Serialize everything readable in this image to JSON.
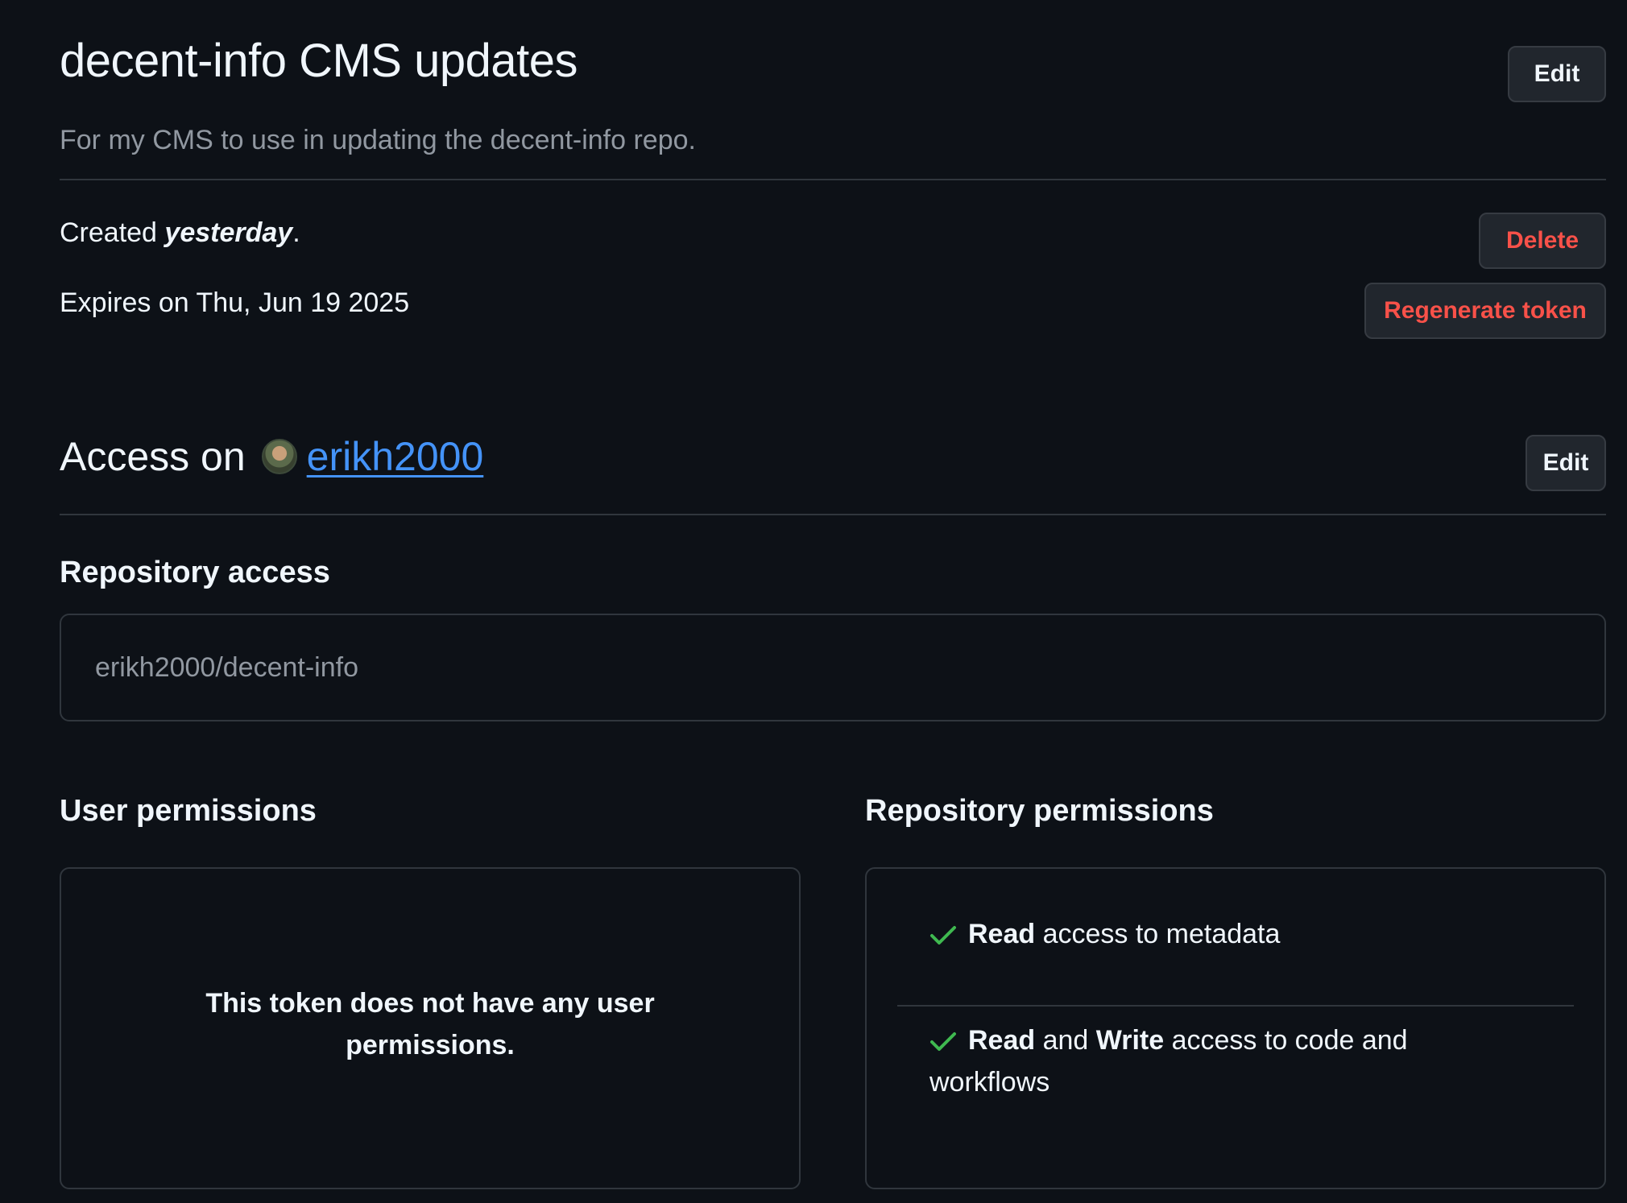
{
  "token": {
    "title": "decent-info CMS updates",
    "description": "For my CMS to use in updating the decent-info repo.",
    "created_prefix": "Created ",
    "created_when": "yesterday",
    "created_suffix": ".",
    "expires": "Expires on Thu, Jun 19 2025"
  },
  "buttons": {
    "edit_label": "Edit",
    "delete_label": "Delete",
    "regenerate_label": "Regenerate token",
    "access_edit_label": "Edit"
  },
  "access": {
    "heading_prefix": "Access on",
    "username": "erikh2000"
  },
  "repository_access": {
    "heading": "Repository access",
    "repo": "erikh2000/decent-info"
  },
  "user_permissions": {
    "heading": "User permissions",
    "empty_message": "This token does not have any user permissions."
  },
  "repository_permissions": {
    "heading": "Repository permissions",
    "items": [
      {
        "icon": "check-icon",
        "parts": [
          {
            "text": "Read",
            "bold": true
          },
          {
            "text": " access to metadata",
            "bold": false
          }
        ]
      },
      {
        "icon": "check-icon",
        "parts": [
          {
            "text": "Read",
            "bold": true
          },
          {
            "text": " and ",
            "bold": false
          },
          {
            "text": "Write",
            "bold": true
          },
          {
            "text": " access to code and workflows",
            "bold": false
          }
        ]
      }
    ]
  },
  "colors": {
    "background": "#0d1117",
    "border": "#30363d",
    "link": "#4493f8",
    "danger": "#f85149",
    "success": "#3fb950"
  }
}
